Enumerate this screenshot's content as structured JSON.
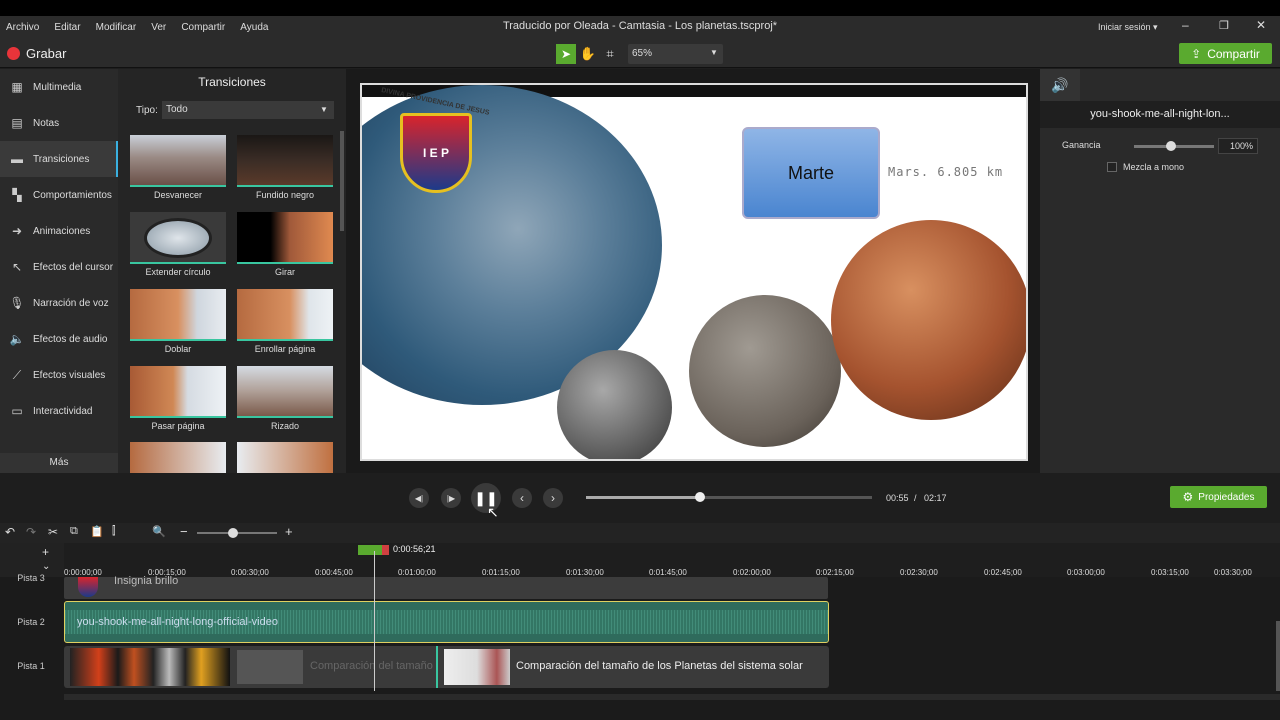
{
  "menu": [
    "Archivo",
    "Editar",
    "Modificar",
    "Ver",
    "Compartir",
    "Ayuda"
  ],
  "window": {
    "title": "Traducido por Oleada - Camtasia - Los planetas.tscproj*",
    "signin": "Iniciar sesión ▾"
  },
  "toolbar": {
    "record": "Grabar",
    "zoom": "65%",
    "share": "Compartir"
  },
  "nav": [
    {
      "label": "Multimedia",
      "icon": "film-icon"
    },
    {
      "label": "Notas",
      "icon": "note-icon"
    },
    {
      "label": "Transiciones",
      "icon": "transition-icon"
    },
    {
      "label": "Comportamientos",
      "icon": "behavior-icon"
    },
    {
      "label": "Animaciones",
      "icon": "animation-icon"
    },
    {
      "label": "Efectos del cursor",
      "icon": "cursor-icon"
    },
    {
      "label": "Narración de voz",
      "icon": "mic-icon"
    },
    {
      "label": "Efectos de audio",
      "icon": "speaker-icon"
    },
    {
      "label": "Efectos visuales",
      "icon": "wand-icon"
    },
    {
      "label": "Interactividad",
      "icon": "interactive-icon"
    }
  ],
  "nav_more": "Más",
  "panel": {
    "title": "Transiciones",
    "type_label": "Tipo:",
    "type_value": "Todo",
    "items": [
      "Desvanecer",
      "Fundido negro",
      "Extender círculo",
      "Girar",
      "Doblar",
      "Enrollar página",
      "Pasar página",
      "Rizado"
    ]
  },
  "canvas": {
    "logo_text": "DIVINA PROVIDENCIA DE JESUS",
    "logo_letters": "I E P",
    "callout": "Marte",
    "caption": "Mars. 6.805 km"
  },
  "props": {
    "clip": "you-shook-me-all-night-lon...",
    "gain_label": "Ganancia",
    "gain_value": "100%",
    "mono": "Mezcla a mono"
  },
  "playback": {
    "current": "00:55",
    "separator": "/",
    "total": "02:17",
    "progress": 0.4,
    "properties": "Propiedades"
  },
  "timeline": {
    "playhead": "0:00:56;21",
    "ticks": [
      "0:00:00;00",
      "0:00:15;00",
      "0:00:30;00",
      "0:00:45;00",
      "0:01:00;00",
      "0:01:15;00",
      "0:01:30;00",
      "0:01:45;00",
      "0:02:00;00",
      "0:02:15;00",
      "0:02:30;00",
      "0:02:45;00",
      "0:03:00;00",
      "0:03:15;00",
      "0:03:30;00"
    ],
    "tracks": [
      "Pista 3",
      "Pista 2",
      "Pista 1"
    ],
    "clip3": "Insignia brillo",
    "clip2": "you-shook-me-all-night-long-official-video",
    "clip1a": "Comparación del tamaño",
    "clip1b": "Comparación del tamaño de los Planetas del sistema solar"
  },
  "colors": {
    "accent_green": "#5aaa2f",
    "teal": "#39c6a0"
  }
}
